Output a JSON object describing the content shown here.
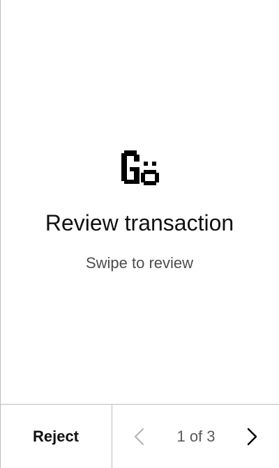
{
  "logo": {
    "icon": "go-logo-icon",
    "text": "Gö"
  },
  "main": {
    "title": "Review transaction",
    "subtitle": "Swipe to review"
  },
  "footer": {
    "reject_label": "Reject",
    "pager": {
      "text": "1 of 3",
      "current": 1,
      "total": 3,
      "prev_icon": "chevron-left-icon",
      "next_icon": "chevron-right-icon"
    }
  },
  "colors": {
    "background": "#ffffff",
    "text": "#111111",
    "subtitle": "#4d4d4d",
    "divider": "#bdbdbd",
    "disabled": "#b5b5b5"
  }
}
